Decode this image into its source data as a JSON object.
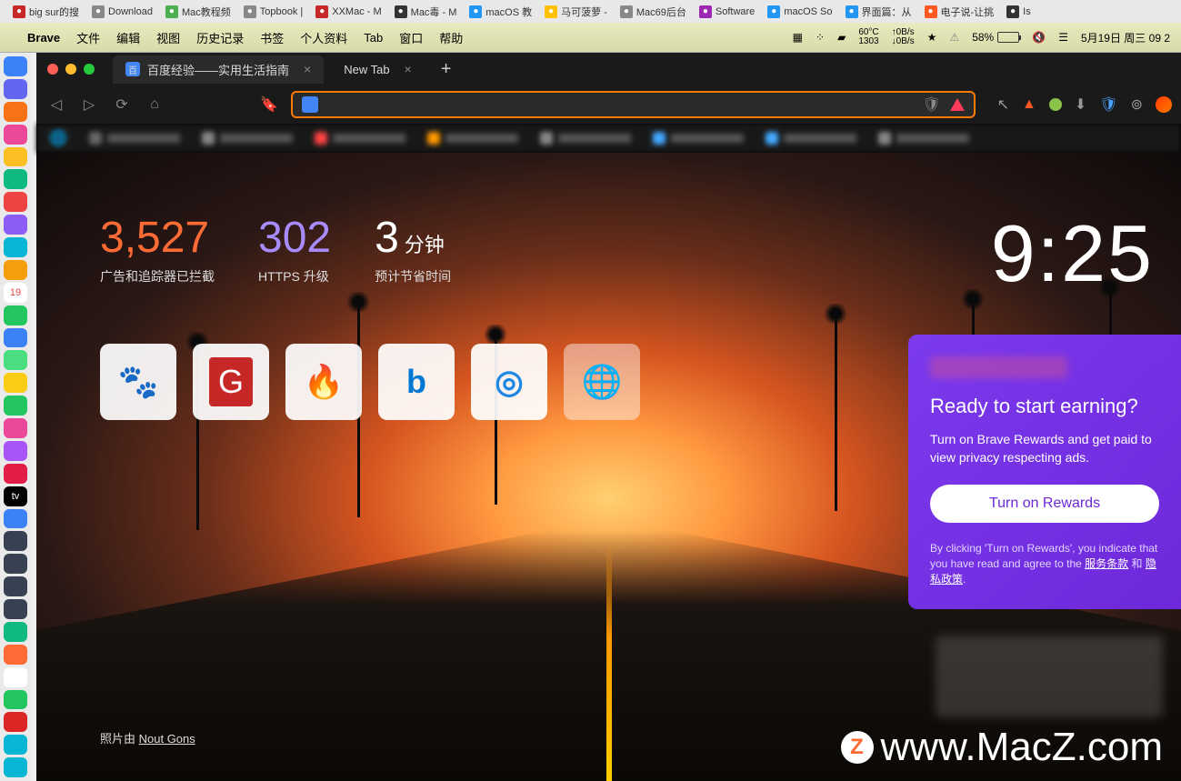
{
  "top_tabs": [
    {
      "label": "big sur的搜",
      "color": "#c62828"
    },
    {
      "label": "Download",
      "color": "#888"
    },
    {
      "label": "Mac教程频",
      "color": "#4caf50"
    },
    {
      "label": "Topbook |",
      "color": "#888"
    },
    {
      "label": "XXMac - M",
      "color": "#c62828"
    },
    {
      "label": "Mac毒 - M",
      "color": "#333"
    },
    {
      "label": "macOS 教",
      "color": "#2196f3"
    },
    {
      "label": "马可菠萝 -",
      "color": "#ffc107"
    },
    {
      "label": "Mac69后台",
      "color": "#888"
    },
    {
      "label": "Software",
      "color": "#9c27b0"
    },
    {
      "label": "macOS So",
      "color": "#2196f3"
    },
    {
      "label": "界面篇：从",
      "color": "#2196f3"
    },
    {
      "label": "电子说-让挑",
      "color": "#ff5722"
    },
    {
      "label": "Is",
      "color": "#333"
    }
  ],
  "menubar": {
    "app": "Brave",
    "items": [
      "文件",
      "编辑",
      "视图",
      "历史记录",
      "书签",
      "个人资料",
      "Tab",
      "窗口",
      "帮助"
    ],
    "sensor_temp": "60°C",
    "sensor_rpm": "1303",
    "net_up": "↑0B/s",
    "net_down": "↓0B/s",
    "battery_pct": "58%",
    "datetime": "5月19日 周三  09 2"
  },
  "dock_apps": [
    {
      "color": "#3b82f6"
    },
    {
      "color": "#6366f1"
    },
    {
      "color": "#f97316"
    },
    {
      "color": "#ec4899"
    },
    {
      "color": "#fbbf24"
    },
    {
      "color": "#10b981"
    },
    {
      "color": "#ef4444"
    },
    {
      "color": "#8b5cf6"
    },
    {
      "color": "#06b6d4"
    },
    {
      "color": "#f59e0b"
    },
    {
      "color": "#fff",
      "text": "19",
      "tc": "#ef4444"
    },
    {
      "color": "#22c55e"
    },
    {
      "color": "#3b82f6"
    },
    {
      "color": "#4ade80"
    },
    {
      "color": "#facc15"
    },
    {
      "color": "#22c55e"
    },
    {
      "color": "#ec4899"
    },
    {
      "color": "#a855f7"
    },
    {
      "color": "#e11d48"
    },
    {
      "color": "#000",
      "text": "tv",
      "tc": "#fff"
    },
    {
      "color": "#3b82f6"
    },
    {
      "color": "#374151"
    },
    {
      "color": "#374151"
    },
    {
      "color": "#374151"
    },
    {
      "color": "#374151"
    },
    {
      "color": "#10b981"
    },
    {
      "color": "#ff6b35"
    },
    {
      "color": "#fff"
    },
    {
      "color": "#22c55e"
    },
    {
      "color": "#dc2626"
    },
    {
      "color": "#06b6d4"
    },
    {
      "color": "#06b6d4"
    }
  ],
  "brave": {
    "tabs": [
      {
        "title": "百度经验——实用生活指南",
        "active": true
      },
      {
        "title": "New Tab",
        "active": false
      }
    ],
    "url_value": "",
    "bookmarks": [
      {
        "c": "#666"
      },
      {
        "c": "#888"
      },
      {
        "c": "#f44"
      },
      {
        "c": "#f90"
      },
      {
        "c": "#888"
      },
      {
        "c": "#4af"
      },
      {
        "c": "#4af"
      },
      {
        "c": "#888"
      }
    ]
  },
  "ntp": {
    "stats": {
      "trackers_num": "3,527",
      "trackers_lbl": "广告和追踪器已拦截",
      "https_num": "302",
      "https_lbl": "HTTPS 升级",
      "time_num": "3",
      "time_unit": "分钟",
      "time_lbl": "预计节省时间"
    },
    "clock": "9:25",
    "tiles": [
      {
        "icon": "🐾",
        "alt": "baidu"
      },
      {
        "icon": "G",
        "bg": "#c62828",
        "alt": "site-g"
      },
      {
        "icon": "🔥",
        "alt": "fire"
      },
      {
        "icon": "b",
        "fg": "#0078d4",
        "alt": "bing"
      },
      {
        "icon": "◎",
        "fg": "#1e88e5",
        "alt": "site-circle"
      },
      {
        "icon": "🌐",
        "dim": true,
        "alt": "globe"
      }
    ],
    "rewards": {
      "title": "Ready to start earning?",
      "body": "Turn on Brave Rewards and get paid to view privacy respecting ads.",
      "button": "Turn on Rewards",
      "fine_pre": "By clicking 'Turn on Rewards', you indicate that you have read and agree to the ",
      "fine_tos": "服务条款",
      "fine_and": " 和 ",
      "fine_priv": "隐私政策",
      "fine_post": "."
    },
    "credit_pre": "照片由 ",
    "credit_name": "Nout Gons",
    "watermark": "www.MacZ.com"
  }
}
